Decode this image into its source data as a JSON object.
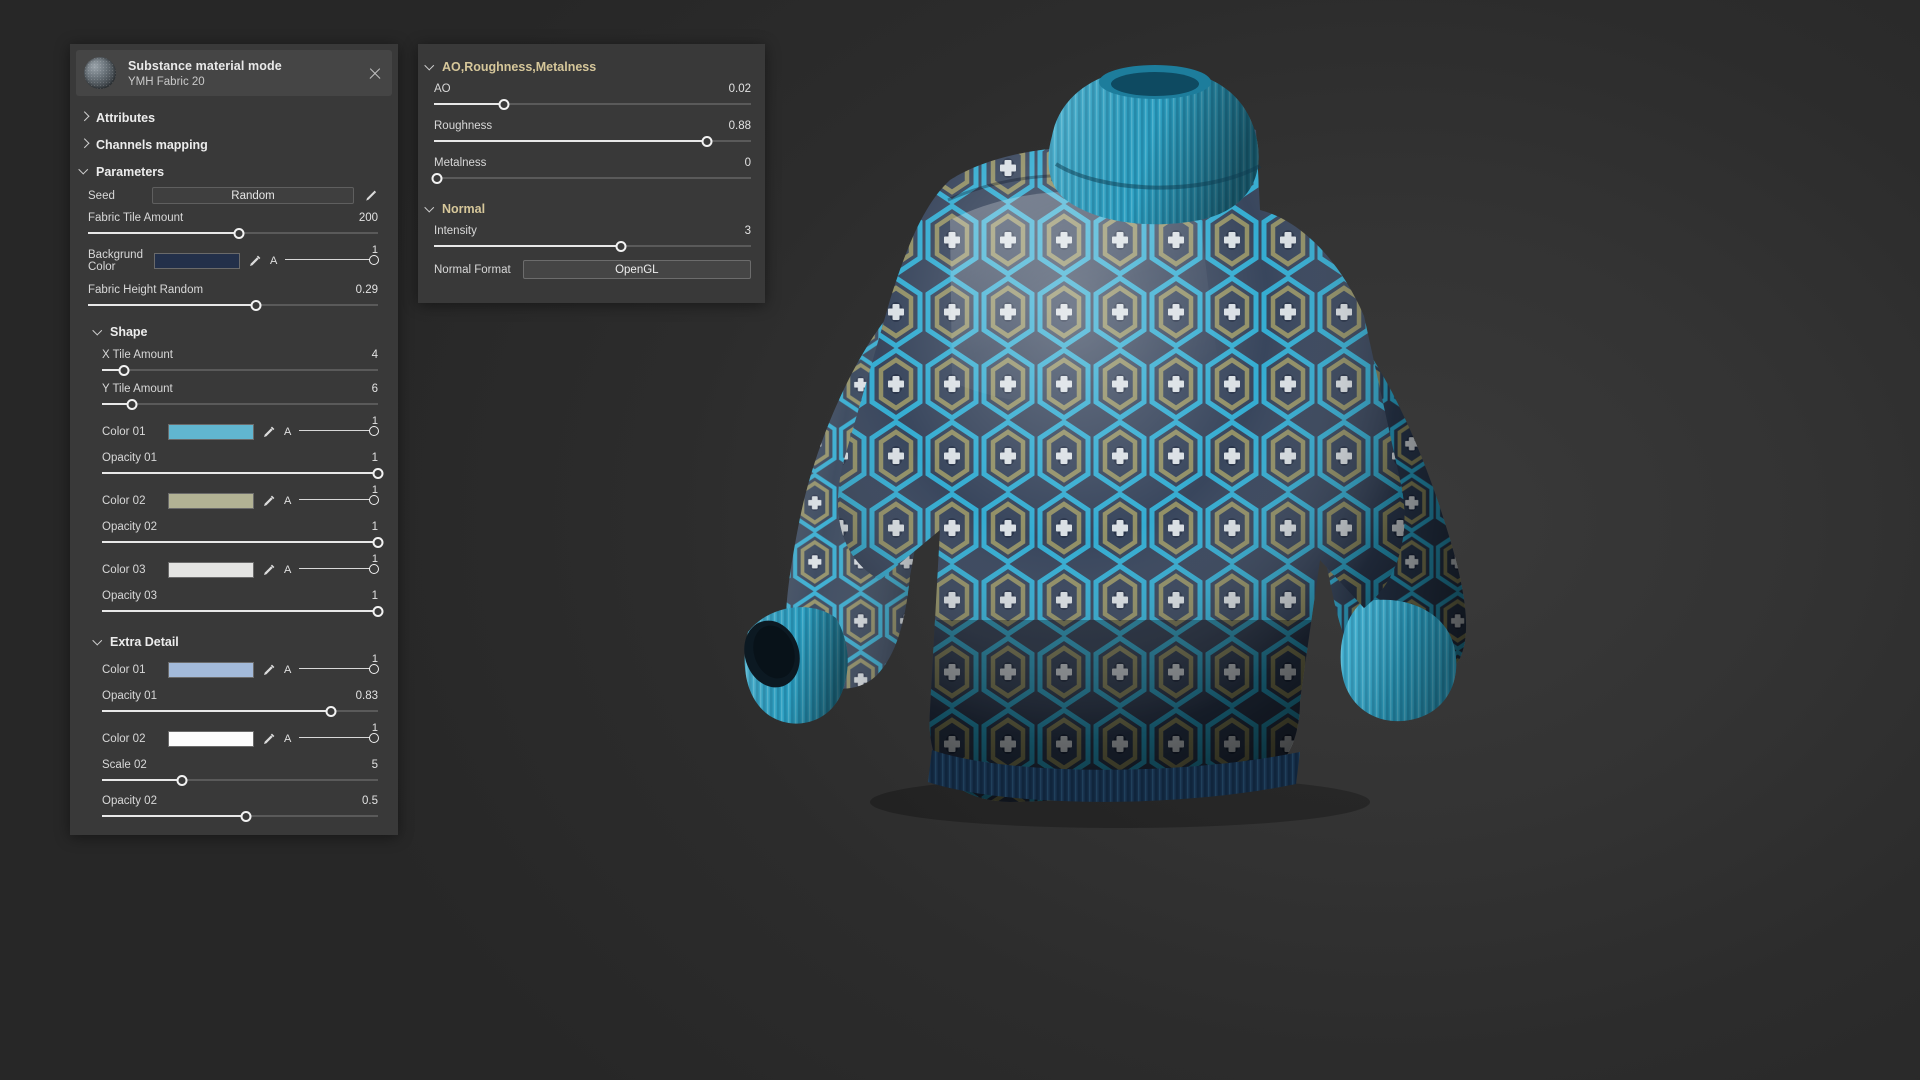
{
  "app": {
    "background_color": "#2b2b2b",
    "viewport_name": "3d-viewport",
    "rendered_object": "patterned turtleneck sweater"
  },
  "material_panel": {
    "title": "Substance material mode",
    "subtitle": "YMH Fabric 20",
    "close_label": "×",
    "thumbnail_name": "material-sphere-thumbnail",
    "sections": [
      {
        "label": "Attributes",
        "expanded": false
      },
      {
        "label": "Channels mapping",
        "expanded": false
      },
      {
        "label": "Parameters",
        "expanded": true
      }
    ],
    "parameters": {
      "seed": {
        "label": "Seed",
        "value": "Random"
      },
      "fabric_tile_amount": {
        "label": "Fabric Tile Amount",
        "value": "200",
        "fill_percent": 52
      },
      "background_color": {
        "label": "Backgrund Color",
        "swatch": "#23304a",
        "alpha_label": "A",
        "alpha_value": "1",
        "alpha_percent": 100
      },
      "fabric_height_random": {
        "label": "Fabric Height Random",
        "value": "0.29",
        "fill_percent": 58
      }
    },
    "shape": {
      "label": "Shape",
      "expanded": true,
      "x_tile_amount": {
        "label": "X Tile Amount",
        "value": "4",
        "fill_percent": 8
      },
      "y_tile_amount": {
        "label": "Y Tile Amount",
        "value": "6",
        "fill_percent": 11
      },
      "colors": [
        {
          "label": "Color 01",
          "swatch": "#61b6d0",
          "alpha_label": "A",
          "alpha_value": "1",
          "alpha_percent": 100
        },
        {
          "label": "Color 02",
          "swatch": "#b2b294",
          "alpha_label": "A",
          "alpha_value": "1",
          "alpha_percent": 100
        },
        {
          "label": "Color 03",
          "swatch": "#e4e4e2",
          "alpha_label": "A",
          "alpha_value": "1",
          "alpha_percent": 100
        }
      ],
      "opacities": [
        {
          "label": "Opacity 01",
          "value": "1",
          "fill_percent": 100
        },
        {
          "label": "Opacity 02",
          "value": "1",
          "fill_percent": 100
        },
        {
          "label": "Opacity 03",
          "value": "1",
          "fill_percent": 100
        }
      ]
    },
    "extra_detail": {
      "label": "Extra Detail",
      "expanded": true,
      "color_01": {
        "label": "Color 01",
        "swatch": "#a3bada",
        "alpha_label": "A",
        "alpha_value": "1",
        "alpha_percent": 100
      },
      "opacity_01": {
        "label": "Opacity 01",
        "value": "0.83",
        "fill_percent": 83
      },
      "color_02": {
        "label": "Color 02",
        "swatch": "#fdfdfd",
        "alpha_label": "A",
        "alpha_value": "1",
        "alpha_percent": 100
      },
      "scale_02": {
        "label": "Scale 02",
        "value": "5",
        "fill_percent": 29
      },
      "opacity_02": {
        "label": "Opacity 02",
        "value": "0.5",
        "fill_percent": 52
      }
    }
  },
  "shading_panel": {
    "arm_section": {
      "label": "AO,Roughness,Metalness",
      "expanded": true,
      "header_color": "#d6c79a"
    },
    "ao": {
      "label": "AO",
      "value": "0.02",
      "fill_percent": 22
    },
    "roughness": {
      "label": "Roughness",
      "value": "0.88",
      "fill_percent": 86
    },
    "metalness": {
      "label": "Metalness",
      "value": "0",
      "fill_percent": 0
    },
    "normal_section": {
      "label": "Normal",
      "expanded": true,
      "header_color": "#d6c79a"
    },
    "intensity": {
      "label": "Intensity",
      "value": "3",
      "fill_percent": 59
    },
    "normal_format": {
      "label": "Normal Format",
      "value": "OpenGL"
    }
  },
  "icons": {
    "close": "close-icon",
    "eyedropper": "eyedropper-icon",
    "pencil": "pencil-icon",
    "chevron_right": "chevron-right-icon",
    "chevron_down": "chevron-down-icon"
  }
}
